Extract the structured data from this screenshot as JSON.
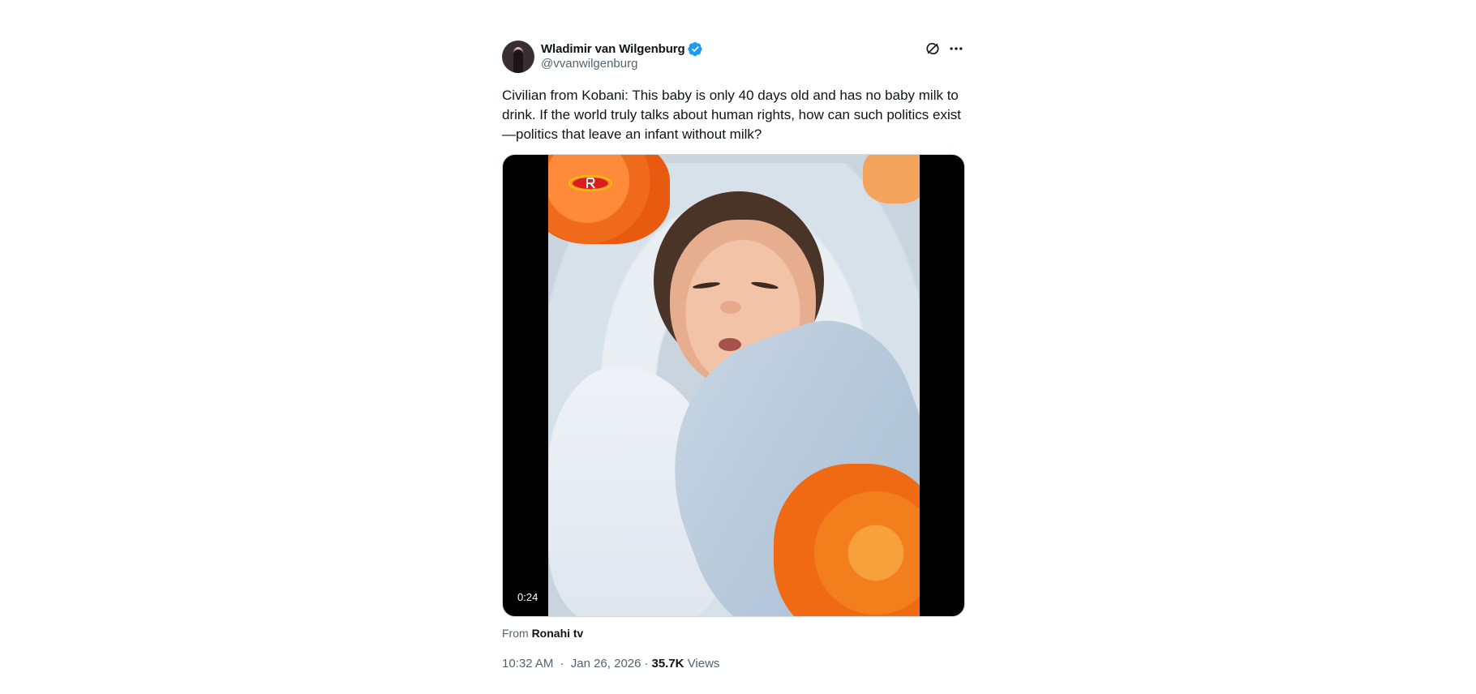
{
  "author": {
    "display_name": "Wladimir van Wilgenburg",
    "handle": "@vvanwilgenburg",
    "verified_color": "#1d9bf0"
  },
  "tweet": {
    "text": "Civilian from Kobani: This baby is only 40 days old and has no baby milk to drink. If the world truly talks about human rights, how can such politics exist—politics that leave an infant without milk?"
  },
  "media": {
    "duration": "0:24",
    "source_prefix": "From",
    "source_name": "Ronahi tv"
  },
  "meta": {
    "time": "10:32 AM",
    "separator": "·",
    "date": "Jan 26, 2026",
    "views_count": "35.7K",
    "views_label": "Views"
  },
  "icons": {
    "verified": "verified-badge-icon",
    "grok": "grok-icon",
    "more": "more-options-icon"
  }
}
